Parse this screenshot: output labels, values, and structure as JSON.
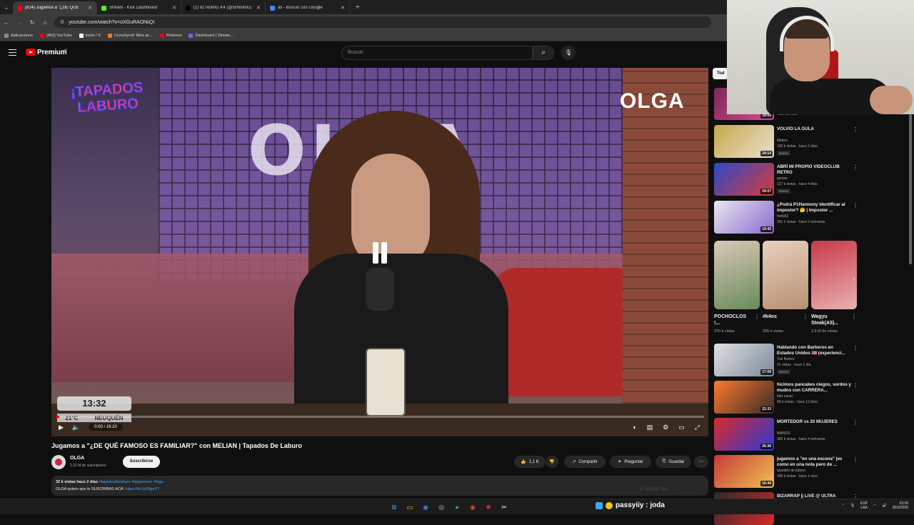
{
  "browser": {
    "tabs": [
      {
        "label": "(814) Jugamos a \"¿DE QUÉ",
        "color": "#ff0000",
        "active": true
      },
      {
        "label": "Stream - Kick Dashboard",
        "color": "#53fc18",
        "active": false
      },
      {
        "label": "(1) 9z NotinG K4 (@9zNotinG)",
        "color": "#000000",
        "active": false
      },
      {
        "label": "as - Buscar con Google",
        "color": "#4285f4",
        "active": false
      }
    ],
    "new_tab": "+",
    "url": "youtube.com/watch?v=oXGuRAOhbQI",
    "bookmarks": [
      {
        "label": "Aplicaciones",
        "color": "#888888"
      },
      {
        "label": "(453) YouTube",
        "color": "#ff0000"
      },
      {
        "label": "Inicio / X",
        "color": "#ffffff"
      },
      {
        "label": "Crunchyroll: Mira an...",
        "color": "#f47521"
      },
      {
        "label": "Pinterest",
        "color": "#e60023"
      },
      {
        "label": "Dashboard | Stream...",
        "color": "#5a6aff"
      }
    ]
  },
  "youtube": {
    "brand": "Premium",
    "country": "AR",
    "search_placeholder": "Buscar"
  },
  "video": {
    "brand_tag": "OLGA",
    "wall_text": "OLGA",
    "show_logo_1": "¡TAPADOS",
    "show_logo_2": "LABURO",
    "clock": "13:32",
    "temperature": "21°C",
    "city": "NEUQUÉN",
    "time": "0:00 / 16:20",
    "progress": 0.005
  },
  "info": {
    "title": "Jugamos a \"¿DE QUÉ FAMOSO ES FAMILIAR?\" con MELIAN | Tapados De Laburo",
    "channel": "OLGA",
    "subscribers": "2,31 M de suscriptores",
    "subscribe": "Suscribirse",
    "likes": "1,1 K",
    "share": "Compartir",
    "ask": "Preguntar",
    "save": "Guardar",
    "views_age": "32 k vistas  hace 2 días",
    "tags": "#tapadosdelaburo #olgaenvivo #olga",
    "desc_line": "OLGA quiere que te SUSCRIBAS ACÁ:",
    "desc_link": "https://bit.ly/OlgaYT"
  },
  "sidebar": {
    "chip": "Tod",
    "top_duration": "18:09",
    "top_meta": "hace 13 días",
    "videos": [
      {
        "title": "VOLVIO LA GULA",
        "channel": "Melian",
        "meta": "160 k vistas · hace 2 días",
        "badge": "Nuevo",
        "duration": "24:14",
        "c1": "#c8a84a",
        "c2": "#e8e0d0"
      },
      {
        "title": "ABRÍ MI PROPIO VIDEOCLUB RETRO",
        "channel": "gertwo",
        "meta": "127 k vistas · hace 4 días",
        "badge": "Nuevo",
        "duration": "59:07",
        "c1": "#2a4ac8",
        "c2": "#d83a3a"
      },
      {
        "title": "¿Podrá P1Harmony identificar al impostor? 🤔 | Impostor ...",
        "channel": "hello82",
        "meta": "301 k vistas · hace 2 semanas",
        "badge": "",
        "duration": "19:45",
        "c1": "#e8e8f0",
        "c2": "#8a6ad0"
      }
    ],
    "shorts": [
      {
        "title": "POCHOCLOS !...",
        "views": "370 k vistas",
        "c1": "#d8c8b8",
        "c2": "#6a8a5a"
      },
      {
        "title": "#k4os",
        "views": "295 k vistas",
        "c1": "#e8d0c0",
        "c2": "#b89070"
      },
      {
        "title": "Wagyu Steak(A5)...",
        "views": "2,6 M de vistas",
        "c1": "#c83a4a",
        "c2": "#e8b0b0"
      }
    ],
    "videos2": [
      {
        "title": "Hablando con Barberos en Estados Unidos 🇺🇸 (experienci...",
        "channel": "Yas Barber",
        "meta": "31 vistas · hace 1 día",
        "badge": "Nuevo",
        "duration": "17:09",
        "c1": "#e0e0e0",
        "c2": "#7a8a9a"
      },
      {
        "title": "hicimos pancakes ciegos, sordos y mudos con CARRERA...",
        "channel": "tdtu canal",
        "meta": "99 k vistas · hace 12 días",
        "badge": "",
        "duration": "22:33",
        "c1": "#ff7a2a",
        "c2": "#3a2a2a"
      },
      {
        "title": "MORTEDOR vs 20 MUJERES",
        "channel": "WANDS",
        "meta": "382 k vistas · hace 4 semanas",
        "badge": "",
        "duration": "26:36",
        "c1": "#d82a2a",
        "c2": "#2a3ad8"
      },
      {
        "title": "jugamos a \"en una escena\" (es como en una nota pero de ...",
        "channel": "tapados de laburo",
        "meta": "348 k vistas · hace 1 mes",
        "badge": "",
        "duration": "16:44",
        "c1": "#c83a3a",
        "c2": "#f0c050"
      },
      {
        "title": "BIZARRAP || LIVE @ ULTRA",
        "channel": "",
        "meta": "",
        "badge": "",
        "duration": "",
        "c1": "#2a2a2a",
        "c2": "#d82a2a"
      }
    ]
  },
  "taskbar": {
    "lang1": "ESP",
    "lang2": "LAA",
    "time": "23:59",
    "date": "30/5/2026"
  },
  "overlay": {
    "user": "passyiiy : joda",
    "faint": "en juguete que ..."
  }
}
